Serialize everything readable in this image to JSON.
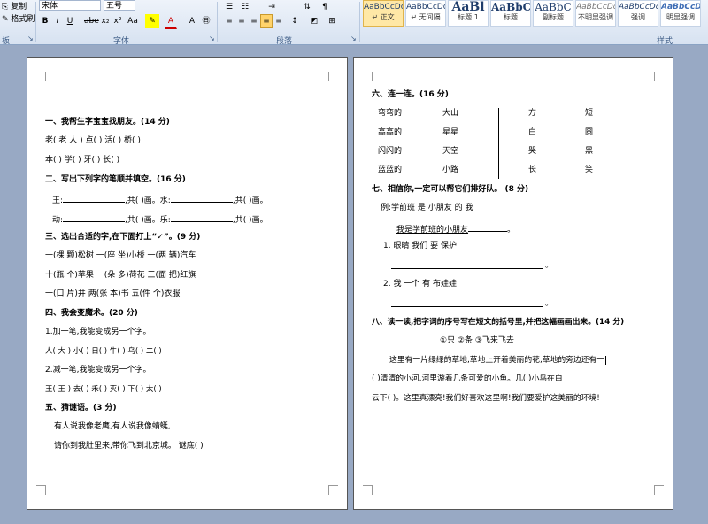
{
  "ribbon": {
    "clipboard": {
      "copy": "复制",
      "format_painter": "格式刷",
      "group": "板"
    },
    "font": {
      "name": "宋体",
      "size": "五号",
      "group": "字体",
      "buttons": [
        "B",
        "I",
        "U",
        "abe",
        "x₂",
        "x²",
        "Aa",
        "A"
      ]
    },
    "paragraph": {
      "group": "段落"
    },
    "styles": {
      "group": "样式",
      "tiles": [
        {
          "preview": "AaBbCcDc",
          "name": "↵ 正文"
        },
        {
          "preview": "AaBbCcDc",
          "name": "↵ 无间隔"
        },
        {
          "preview": "AaBl",
          "name": "标题 1"
        },
        {
          "preview": "AaBbC",
          "name": "标题"
        },
        {
          "preview": "AaBbC",
          "name": "副标题"
        },
        {
          "preview": "AaBbCcDc",
          "name": "不明显强调"
        },
        {
          "preview": "AaBbCcDc",
          "name": "强调"
        },
        {
          "preview": "AaBbCcDc",
          "name": "明显强调"
        }
      ]
    }
  },
  "page1": {
    "s1_title": "一、我帮生字宝宝找朋友。(14 分)",
    "s1_r1": "老(  老  人  )   点(          )   活(          )   桥(          )",
    "s1_r2": "本(          )   学(          )   牙(          )   长(          )",
    "s2_title": "二、写出下列字的笔顺并填空。(16 分)",
    "s2_r1a": "王:",
    "s2_r1b": ",共(  )画。水:",
    "s2_r1c": ",共(  )画。",
    "s2_r2a": "动:",
    "s2_r2b": ",共(  )画。乐:",
    "s2_r2c": ",共(  )画。",
    "s3_title": "三、选出合适的字,在下面打上“✓”。(9 分)",
    "s3_r1": "一(棵  颗)松树       一(座  坐)小桥       一(两  辆)汽车",
    "s3_r2": "十(瓶  个)苹果       一(朵  多)荷花       三(面  把)红旗",
    "s3_r3": "一(口  片)井          两(张  本)书          五(件  个)衣服",
    "s4_title": "四、我会变魔术。(20 分)",
    "s4_l1": "1.加一笔,我能变成另一个字。",
    "s4_l2": "人( 大 )   小(          )     日(          )     牛(          )     乌(          )     二(          )",
    "s4_l3": "2.减一笔,我能变成另一个字。",
    "s4_l4": "王( 王 )   去(          )     禾(          )     灭(          )     下(          )     太(          )",
    "s5_title": "五、猜谜语。(3 分)",
    "s5_l1": "有人说我像老鹰,有人说我像蜻蜓,",
    "s5_l2": "请你到我肚里来,带你飞到北京城。            谜底(          )"
  },
  "page2": {
    "s6_title": "六、连一连。(16 分)",
    "s6_left_a": [
      "弯弯的",
      "高高的",
      "闪闪的",
      "蓝蓝的"
    ],
    "s6_left_b": [
      "大山",
      "星星",
      "天空",
      "小路"
    ],
    "s6_right_a": [
      "方",
      "白",
      "哭",
      "长"
    ],
    "s6_right_b": [
      "短",
      "圆",
      "黑",
      "笑"
    ],
    "s7_title": "七、相信你,一定可以帮它们排好队。  (8 分)",
    "s7_ex": "例:学前班     是     小朋友       的      我",
    "s7_ans": "我是学前班的小朋友",
    "s7_q1": "1.  眼睛       我们       要       保护",
    "s7_q2": "2.  我      一个       有        布娃娃",
    "period": "。",
    "s8_title": "八、读一读,把字词的序号写在短文的括号里,并把这幅画画出来。(14 分)",
    "s8_opts": "①只          ②条          ③飞来飞去",
    "s8_p1": "这里有一片绿绿的草地,草地上开着美丽的花,草地的旁边还有一",
    "s8_p2": "(          )清清的小河,河里游着几条可爱的小鱼。几(          )小鸟在白",
    "s8_p3": "云下(          )。这里真漂亮!我们好喜欢这里啊!我们要爱护这美丽的环境!"
  }
}
